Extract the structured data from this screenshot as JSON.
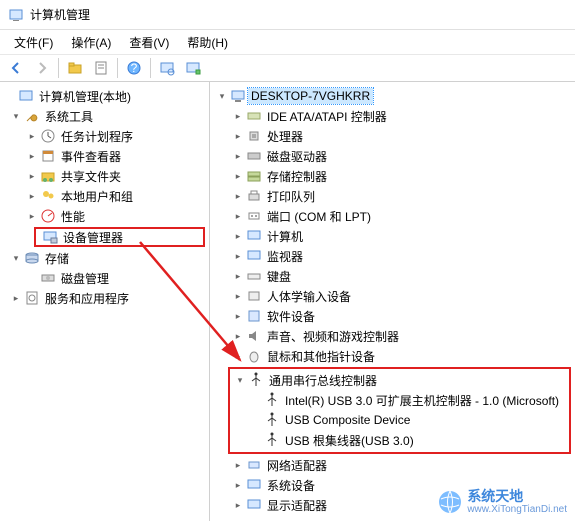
{
  "window": {
    "title": "计算机管理"
  },
  "menu": {
    "file": "文件(F)",
    "action": "操作(A)",
    "view": "查看(V)",
    "help": "帮助(H)"
  },
  "toolbar_icons": {
    "back": "back-arrow",
    "forward": "forward-arrow",
    "up": "up-level",
    "properties": "properties",
    "refresh": "refresh",
    "export": "export",
    "help": "help"
  },
  "left_tree": {
    "root": "计算机管理(本地)",
    "system_tools": {
      "label": "系统工具",
      "children": {
        "task_scheduler": "任务计划程序",
        "event_viewer": "事件查看器",
        "shared_folders": "共享文件夹",
        "local_users": "本地用户和组",
        "performance": "性能",
        "device_manager": "设备管理器"
      }
    },
    "storage": {
      "label": "存储",
      "disk_mgmt": "磁盘管理"
    },
    "services_apps": "服务和应用程序"
  },
  "right_tree": {
    "computer": "DESKTOP-7VGHKRR",
    "nodes": {
      "ide": "IDE ATA/ATAPI 控制器",
      "cpu": "处理器",
      "disk_drives": "磁盘驱动器",
      "storage_ctrl": "存储控制器",
      "print_queue": "打印队列",
      "ports": "端口 (COM 和 LPT)",
      "computers": "计算机",
      "monitors": "监视器",
      "keyboards": "键盘",
      "hid": "人体学输入设备",
      "software_dev": "软件设备",
      "sound": "声音、视频和游戏控制器",
      "mouse": "鼠标和其他指针设备",
      "usb_ctrl": {
        "label": "通用串行总线控制器",
        "children": {
          "c0": "Intel(R) USB 3.0 可扩展主机控制器 - 1.0 (Microsoft)",
          "c1": "USB Composite Device",
          "c2": "USB 根集线器(USB 3.0)"
        }
      },
      "net_adapters": "网络适配器",
      "sys_devices": "系统设备",
      "display_adapters": "显示适配器"
    }
  },
  "watermark": {
    "cn": "系统天地",
    "url": "www.XiTongTianDi.net"
  }
}
